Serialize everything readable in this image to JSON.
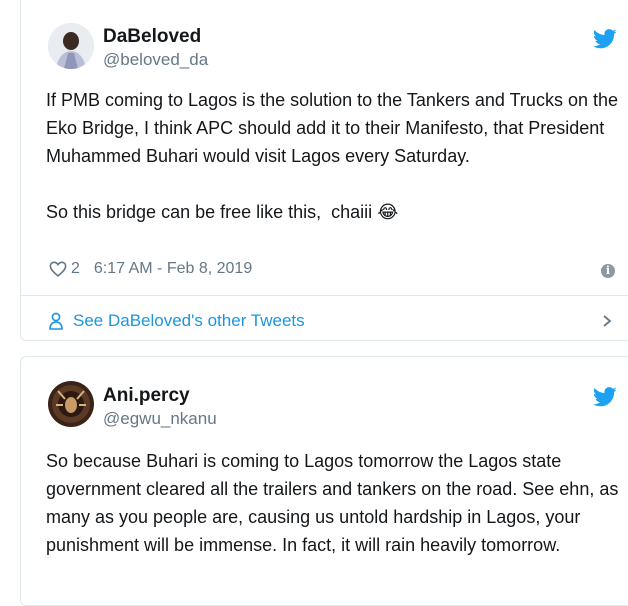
{
  "tweet1": {
    "name": "DaBeloved",
    "handle": "@beloved_da",
    "paragraphs": [
      "If PMB coming to Lagos is the solution to the Tankers and Trucks on the Eko Bridge, I think APC should add it to their Manifesto, that President Muhammed Buhari would visit Lagos every Saturday.",
      "So this bridge can be free like this,  chaiii"
    ],
    "emoji": "😂",
    "likes": "2",
    "timestamp": "6:17 AM - Feb 8, 2019",
    "info_glyph": "i",
    "footer_link": "See DaBeloved's other Tweets"
  },
  "tweet2": {
    "name": "Ani.percy",
    "handle": "@egwu_nkanu",
    "paragraphs": [
      "So because Buhari is coming to Lagos tomorrow the Lagos state government cleared all the trailers and tankers on the road. See ehn, as many as you people are, causing us untold hardship in Lagos, your punishment will be immense. In fact, it will rain heavily tomorrow."
    ]
  },
  "colors": {
    "twitter_blue": "#1da1f2",
    "link_blue": "#1b95e0",
    "text": "#14171a",
    "muted": "#657786",
    "border": "#e1e8ed"
  },
  "icons": {
    "bird": "twitter-bird-icon",
    "heart": "heart-icon",
    "info": "info-icon",
    "person": "person-icon",
    "chevron": "chevron-right-icon"
  }
}
